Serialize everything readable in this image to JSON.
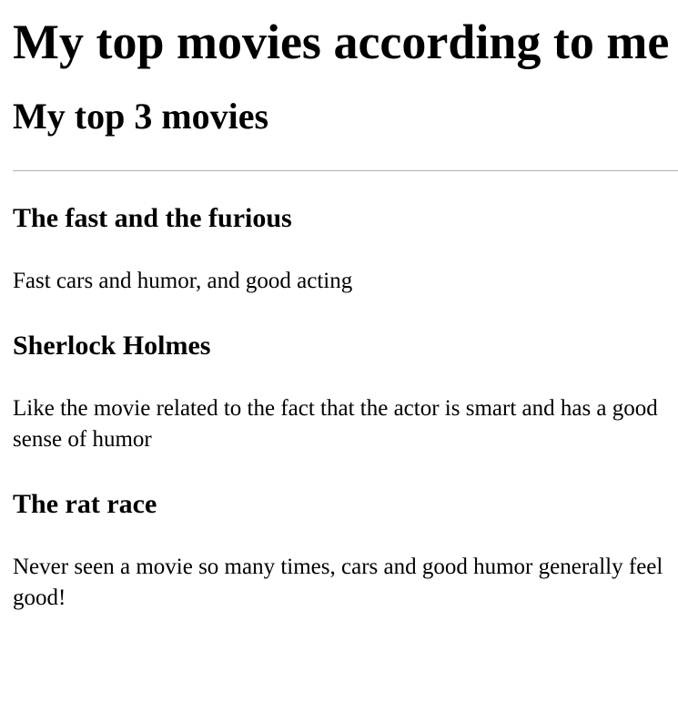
{
  "page": {
    "title": "My top movies according to me",
    "subtitle": "My top 3 movies"
  },
  "movies": [
    {
      "title": "The fast and the furious",
      "description": "Fast cars and humor, and good acting"
    },
    {
      "title": "Sherlock Holmes",
      "description": "Like the movie related to the fact that the actor is smart and has a good sense of humor"
    },
    {
      "title": "The rat race",
      "description": "Never seen a movie so many times, cars and good humor generally feel good!"
    }
  ]
}
